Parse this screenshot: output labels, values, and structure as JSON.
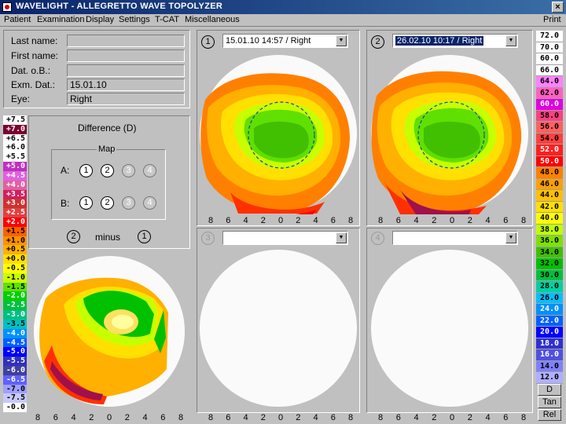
{
  "window": {
    "title": "WAVELIGHT - ALLEGRETTO WAVE TOPOLYZER",
    "close": "×"
  },
  "menu": [
    "Patient",
    "Examination",
    "Display",
    "Settings",
    "T-CAT",
    "Miscellaneous"
  ],
  "print": "Print",
  "patient": {
    "last_name_label": "Last name:",
    "first_name_label": "First name:",
    "dob_label": "Dat. o.B.:",
    "exam_date_label": "Exm. Dat.:",
    "exam_date": "15.01.10",
    "eye_label": "Eye:",
    "eye": "Right"
  },
  "difference": {
    "title": "Difference (D)",
    "map_label": "Map",
    "a_label": "A:",
    "b_label": "B:",
    "slots": [
      "1",
      "2",
      "3",
      "4"
    ],
    "left_operand": "2",
    "minus": "minus",
    "right_operand": "1"
  },
  "maps": [
    {
      "num": "1",
      "combo": "15.01.10  14:57 / Right"
    },
    {
      "num": "2",
      "combo": "26.02.10  10:17 / Right"
    },
    {
      "num": "3",
      "combo": ""
    },
    {
      "num": "4",
      "combo": ""
    }
  ],
  "axis_ticks": [
    "8",
    "6",
    "4",
    "2",
    "0",
    "2",
    "4",
    "6",
    "8"
  ],
  "left_scale": [
    "+7.5",
    "+7.0",
    "+6.5",
    "+6.0",
    "+5.5",
    "+5.0",
    "+4.5",
    "+4.0",
    "+3.5",
    "+3.0",
    "+2.5",
    "+2.0",
    "+1.5",
    "+1.0",
    "+0.5",
    "+0.0",
    "-0.5",
    "-1.0",
    "-1.5",
    "-2.0",
    "-2.5",
    "-3.0",
    "-3.5",
    "-4.0",
    "-4.5",
    "-5.0",
    "-5.5",
    "-6.0",
    "-6.5",
    "-7.0",
    "-7.5",
    "-0.0"
  ],
  "right_scale": [
    "72.0",
    "70.0",
    "60.0",
    "66.0",
    "64.0",
    "62.0",
    "60.0",
    "58.0",
    "56.0",
    "54.0",
    "52.0",
    "50.0",
    "48.0",
    "46.0",
    "44.0",
    "42.0",
    "40.0",
    "38.0",
    "36.0",
    "34.0",
    "32.0",
    "30.0",
    "28.0",
    "26.0",
    "24.0",
    "22.0",
    "20.0",
    "18.0",
    "16.0",
    "14.0",
    "12.0"
  ],
  "right_buttons": [
    "D",
    "Tan",
    "Rel"
  ],
  "colors": {
    "left_scale_bg": [
      "#ffffff",
      "#7a0030",
      "#ffffff",
      "#ffffff",
      "#ffffff",
      "#c030c0",
      "#e060e0",
      "#e060a0",
      "#d02060",
      "#d03030",
      "#e04040",
      "#ff0000",
      "#ff6000",
      "#ff9000",
      "#ffb000",
      "#ffe000",
      "#ffff00",
      "#c8ff00",
      "#60e000",
      "#00d000",
      "#00c040",
      "#00c080",
      "#00c0c0",
      "#0090ff",
      "#0060ff",
      "#0000ff",
      "#3030c0",
      "#4040a0",
      "#6060ff",
      "#a0a0ff",
      "#c8c8ff",
      "#ffffff"
    ],
    "left_scale_fg": [
      "#000",
      "#fff",
      "#000",
      "#000",
      "#000",
      "#fff",
      "#fff",
      "#fff",
      "#fff",
      "#fff",
      "#fff",
      "#fff",
      "#000",
      "#000",
      "#000",
      "#000",
      "#000",
      "#000",
      "#000",
      "#fff",
      "#fff",
      "#fff",
      "#000",
      "#fff",
      "#fff",
      "#fff",
      "#fff",
      "#fff",
      "#fff",
      "#000",
      "#000",
      "#000"
    ],
    "right_scale_bg": [
      "#ffffff",
      "#ffffff",
      "#ffffff",
      "#ffffff",
      "#ff80ff",
      "#ff60c0",
      "#e000e0",
      "#ff4080",
      "#ff6060",
      "#ff4040",
      "#ff2020",
      "#ff0000",
      "#ff8000",
      "#ffa000",
      "#ffc000",
      "#ffe000",
      "#ffff00",
      "#c0ff00",
      "#80e000",
      "#40c000",
      "#00c000",
      "#00c040",
      "#00d0a0",
      "#00c0ff",
      "#0090ff",
      "#0060ff",
      "#0000ff",
      "#3030d0",
      "#5050e0",
      "#8080ff",
      "#b0b0ff"
    ],
    "right_scale_fg": [
      "#000",
      "#000",
      "#000",
      "#000",
      "#000",
      "#000",
      "#fff",
      "#000",
      "#000",
      "#000",
      "#fff",
      "#fff",
      "#000",
      "#000",
      "#000",
      "#000",
      "#000",
      "#000",
      "#000",
      "#000",
      "#000",
      "#000",
      "#000",
      "#000",
      "#fff",
      "#fff",
      "#fff",
      "#fff",
      "#fff",
      "#000",
      "#000"
    ]
  }
}
